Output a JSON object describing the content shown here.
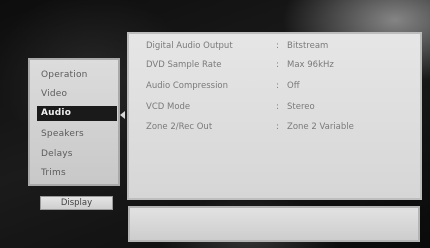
{
  "menu": {
    "items": [
      {
        "label": "Operation"
      },
      {
        "label": "Video"
      },
      {
        "label": "Audio"
      },
      {
        "label": "Speakers"
      },
      {
        "label": "Delays"
      },
      {
        "label": "Trims"
      }
    ],
    "selected": "Audio",
    "display_label": "Display"
  },
  "settings": [
    {
      "label": "Digital Audio Output",
      "value": "Bitstream"
    },
    {
      "label": "DVD Sample Rate",
      "value": "Max 96kHz"
    },
    {
      "label": "Audio Compression",
      "value": "Off"
    },
    {
      "label": "VCD Mode",
      "value": "Stereo"
    },
    {
      "label": "Zone 2/Rec Out",
      "value": "Zone 2 Variable"
    }
  ]
}
